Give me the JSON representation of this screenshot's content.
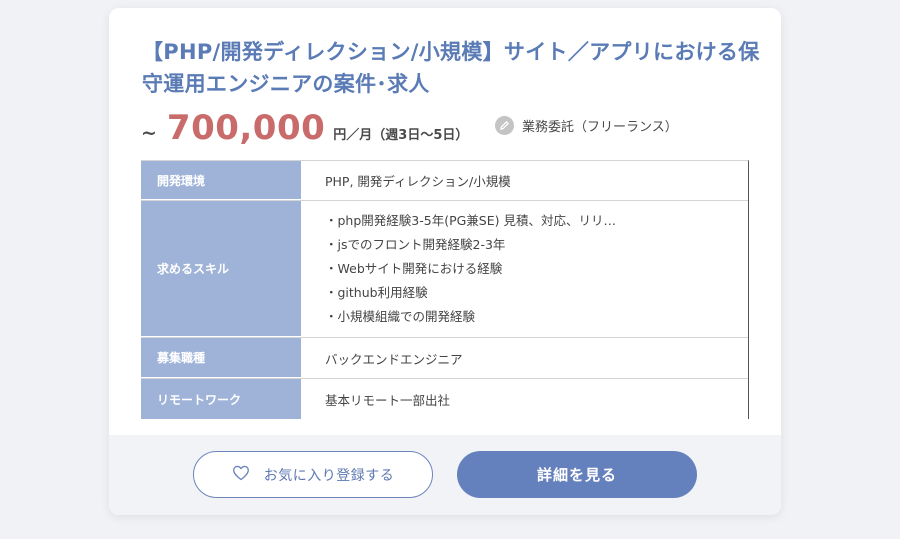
{
  "job": {
    "title": "【PHP/開発ディレクション/小規模】サイト／アプリにおける保守運用エンジニアの案件･求人",
    "price_prefix": "~",
    "price_amount": "700,000",
    "price_unit": "円／月（週3日～5日）",
    "contract_type": "業務委託（フリーランス）"
  },
  "table": {
    "rows": [
      {
        "label": "開発環境",
        "value": "PHP, 開発ディレクション/小規模"
      },
      {
        "label": "求めるスキル",
        "items": [
          "・php開発経験3-5年(PG兼SE) 見積、対応、リリ…",
          "・jsでのフロント開発経験2-3年",
          "・Webサイト開発における経験",
          "・github利用経験",
          "・小規模組織での開発経験"
        ]
      },
      {
        "label": "募集職種",
        "value": "バックエンドエンジニア"
      },
      {
        "label": "リモートワーク",
        "value": "基本リモート一部出社"
      }
    ]
  },
  "actions": {
    "favorite_label": "お気に入り登録する",
    "detail_label": "詳細を見る"
  },
  "icons": {
    "contract": "pencil-icon",
    "favorite": "heart-icon"
  },
  "colors": {
    "title": "#5a7bb5",
    "price": "#c96b6b",
    "table_header": "#9fb3d8",
    "primary_button": "#6581bd"
  }
}
